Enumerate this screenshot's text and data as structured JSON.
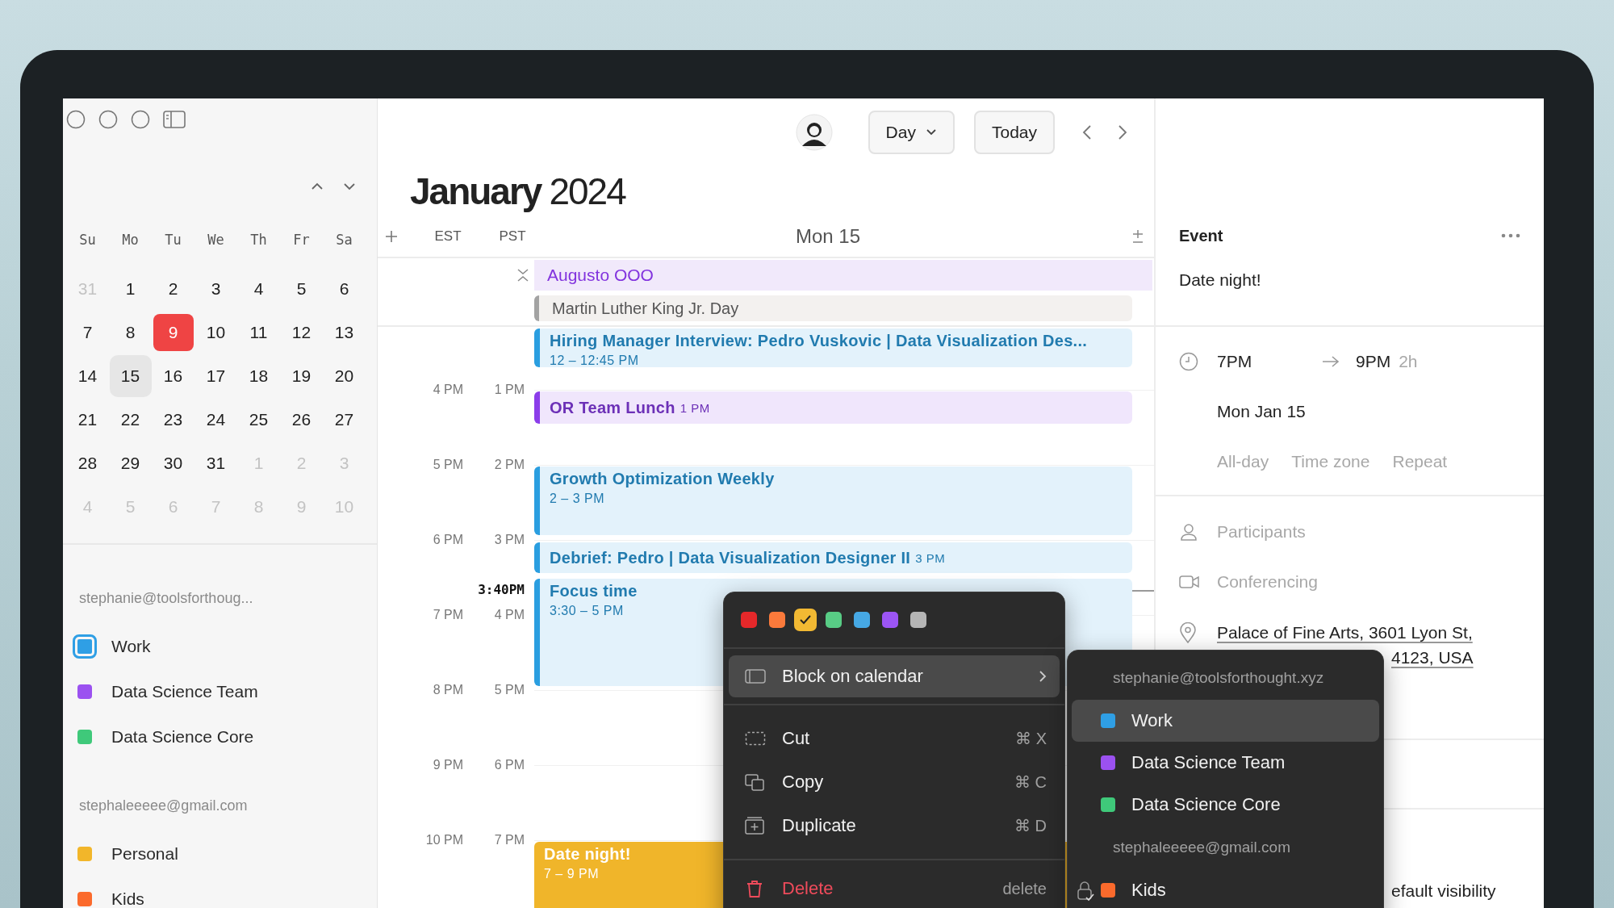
{
  "sidebar": {
    "weekdays": [
      "Su",
      "Mo",
      "Tu",
      "We",
      "Th",
      "Fr",
      "Sa"
    ],
    "days": [
      {
        "label": "31",
        "outside": true,
        "today": false,
        "selected": false
      },
      {
        "label": "1",
        "outside": false,
        "today": false,
        "selected": false
      },
      {
        "label": "2",
        "outside": false,
        "today": false,
        "selected": false
      },
      {
        "label": "3",
        "outside": false,
        "today": false,
        "selected": false
      },
      {
        "label": "4",
        "outside": false,
        "today": false,
        "selected": false
      },
      {
        "label": "5",
        "outside": false,
        "today": false,
        "selected": false
      },
      {
        "label": "6",
        "outside": false,
        "today": false,
        "selected": false
      },
      {
        "label": "7",
        "outside": false,
        "today": false,
        "selected": false
      },
      {
        "label": "8",
        "outside": false,
        "today": false,
        "selected": false
      },
      {
        "label": "9",
        "outside": false,
        "today": true,
        "selected": false
      },
      {
        "label": "10",
        "outside": false,
        "today": false,
        "selected": false
      },
      {
        "label": "11",
        "outside": false,
        "today": false,
        "selected": false
      },
      {
        "label": "12",
        "outside": false,
        "today": false,
        "selected": false
      },
      {
        "label": "13",
        "outside": false,
        "today": false,
        "selected": false
      },
      {
        "label": "14",
        "outside": false,
        "today": false,
        "selected": false
      },
      {
        "label": "15",
        "outside": false,
        "today": false,
        "selected": true
      },
      {
        "label": "16",
        "outside": false,
        "today": false,
        "selected": false
      },
      {
        "label": "17",
        "outside": false,
        "today": false,
        "selected": false
      },
      {
        "label": "18",
        "outside": false,
        "today": false,
        "selected": false
      },
      {
        "label": "19",
        "outside": false,
        "today": false,
        "selected": false
      },
      {
        "label": "20",
        "outside": false,
        "today": false,
        "selected": false
      },
      {
        "label": "21",
        "outside": false,
        "today": false,
        "selected": false
      },
      {
        "label": "22",
        "outside": false,
        "today": false,
        "selected": false
      },
      {
        "label": "23",
        "outside": false,
        "today": false,
        "selected": false
      },
      {
        "label": "24",
        "outside": false,
        "today": false,
        "selected": false
      },
      {
        "label": "25",
        "outside": false,
        "today": false,
        "selected": false
      },
      {
        "label": "26",
        "outside": false,
        "today": false,
        "selected": false
      },
      {
        "label": "27",
        "outside": false,
        "today": false,
        "selected": false
      },
      {
        "label": "28",
        "outside": false,
        "today": false,
        "selected": false
      },
      {
        "label": "29",
        "outside": false,
        "today": false,
        "selected": false
      },
      {
        "label": "30",
        "outside": false,
        "today": false,
        "selected": false
      },
      {
        "label": "31",
        "outside": false,
        "today": false,
        "selected": false
      },
      {
        "label": "1",
        "outside": true,
        "today": false,
        "selected": false
      },
      {
        "label": "2",
        "outside": true,
        "today": false,
        "selected": false
      },
      {
        "label": "3",
        "outside": true,
        "today": false,
        "selected": false
      },
      {
        "label": "4",
        "outside": true,
        "today": false,
        "selected": false
      },
      {
        "label": "5",
        "outside": true,
        "today": false,
        "selected": false
      },
      {
        "label": "6",
        "outside": true,
        "today": false,
        "selected": false
      },
      {
        "label": "7",
        "outside": true,
        "today": false,
        "selected": false
      },
      {
        "label": "8",
        "outside": true,
        "today": false,
        "selected": false
      },
      {
        "label": "9",
        "outside": true,
        "today": false,
        "selected": false
      },
      {
        "label": "10",
        "outside": true,
        "today": false,
        "selected": false
      }
    ],
    "accounts": [
      {
        "email": "stephanie@toolsforthoug...",
        "calendars": [
          {
            "name": "Work",
            "color": "#2f9fe5",
            "selected": true
          },
          {
            "name": "Data Science Team",
            "color": "#9b51f0",
            "selected": false
          },
          {
            "name": "Data Science Core",
            "color": "#3fc97a",
            "selected": false
          }
        ]
      },
      {
        "email": "stephaleeeee@gmail.com",
        "calendars": [
          {
            "name": "Personal",
            "color": "#f2b62a",
            "selected": false
          },
          {
            "name": "Kids",
            "color": "#fb6a2c",
            "selected": false
          }
        ]
      }
    ]
  },
  "toolbar": {
    "view": "Day",
    "today": "Today"
  },
  "title": {
    "month": "January",
    "year": "2024"
  },
  "day_header": {
    "timezones": [
      "EST",
      "PST"
    ],
    "day": "Mon 15"
  },
  "all_day": [
    {
      "title": "Augusto OOO",
      "color": "#8233de",
      "kind": "banner"
    },
    {
      "title": "Martin Luther King Jr. Day",
      "color": "#a3a3a3",
      "kind": "holiday"
    }
  ],
  "hours": [
    {
      "est": "4 PM",
      "pst": "1 PM"
    },
    {
      "est": "5 PM",
      "pst": "2 PM"
    },
    {
      "est": "6 PM",
      "pst": "3 PM"
    },
    {
      "est": "7 PM",
      "pst": "4 PM"
    },
    {
      "est": "8 PM",
      "pst": "5 PM"
    },
    {
      "est": "9 PM",
      "pst": "6 PM"
    },
    {
      "est": "10 PM",
      "pst": "7 PM"
    }
  ],
  "now": "3:40PM",
  "events": [
    {
      "title": "Hiring Manager Interview: Pedro Vuskovic | Data Visualization Des...",
      "time": "12 – 12:45 PM",
      "color": "#2a9ee0",
      "kind": "block"
    },
    {
      "title": "OR Team Lunch",
      "time": "1 PM",
      "color": "#8b3dea",
      "kind": "inline"
    },
    {
      "title": "Growth Optimization Weekly",
      "time": "2 – 3 PM",
      "color": "#2a9ee0",
      "kind": "block"
    },
    {
      "title": "Debrief: Pedro | Data Visualization Designer II",
      "time": "3 PM",
      "color": "#2a9ee0",
      "kind": "inline"
    },
    {
      "title": "Focus time",
      "time": "3:30 – 5 PM",
      "color": "#2a9ee0",
      "kind": "block"
    },
    {
      "title": "Date night!",
      "time": "7 – 9 PM",
      "color": "#f0b52a",
      "kind": "filled"
    }
  ],
  "event_panel": {
    "heading": "Event",
    "title": "Date night!",
    "start": "7PM",
    "end": "9PM",
    "duration": "2h",
    "date": "Mon Jan 15",
    "options": [
      "All-day",
      "Time zone",
      "Repeat"
    ],
    "participants": {
      "placeholder": "Participants"
    },
    "conferencing": {
      "placeholder": "Conferencing"
    },
    "location_line_1": "Palace of Fine Arts, 3601 Lyon St,",
    "location_line_2": "4123, USA",
    "visibility": "efault visibility"
  },
  "context_menu": {
    "colors": [
      {
        "color": "#e5282a",
        "selected": false
      },
      {
        "color": "#fb7a3b",
        "selected": false
      },
      {
        "color": "#f2b933",
        "selected": true
      },
      {
        "color": "#58cc85",
        "selected": false
      },
      {
        "color": "#46a8e4",
        "selected": false
      },
      {
        "color": "#9c55f4",
        "selected": false
      },
      {
        "color": "#b5b5b5",
        "selected": false
      }
    ],
    "items": [
      {
        "kind": "submenu",
        "label": "Block on calendar",
        "selected": true
      },
      {
        "kind": "action",
        "label": "Cut",
        "shortcut": "⌘ X",
        "selected": false
      },
      {
        "kind": "action",
        "label": "Copy",
        "shortcut": "⌘ C",
        "selected": false
      },
      {
        "kind": "action",
        "label": "Duplicate",
        "shortcut": "⌘ D",
        "selected": false
      },
      {
        "kind": "danger",
        "label": "Delete",
        "shortcut": "delete",
        "selected": false
      }
    ],
    "submenu": [
      {
        "kind": "account",
        "label": "stephanie@toolsforthought.xyz"
      },
      {
        "kind": "calendar",
        "label": "Work",
        "color": "#2f9fe5",
        "selected": true,
        "locked": false
      },
      {
        "kind": "calendar",
        "label": "Data Science Team",
        "color": "#9b51f0",
        "selected": false,
        "locked": false
      },
      {
        "kind": "calendar",
        "label": "Data Science Core",
        "color": "#3fc97a",
        "selected": false,
        "locked": false
      },
      {
        "kind": "account",
        "label": "stephaleeeee@gmail.com"
      },
      {
        "kind": "calendar",
        "label": "Kids",
        "color": "#fb6a2c",
        "selected": false,
        "locked": true
      }
    ]
  }
}
